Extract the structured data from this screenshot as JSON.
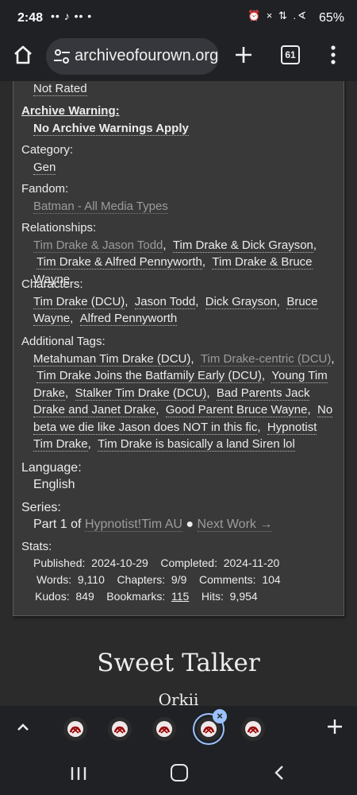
{
  "status_bar": {
    "time": "2:48",
    "notification_icons": "•• ♪ ••  •",
    "system_icons": "⏰ × ⇅ .∢",
    "battery": "65%"
  },
  "browser": {
    "url": "archiveofourown.org",
    "tab_count": "61"
  },
  "work_meta": {
    "rating_value": "Not Rated",
    "archive_warning_label": "Archive Warning:",
    "archive_warning_value": "No Archive Warnings Apply",
    "category_label": "Category:",
    "category_value": "Gen",
    "fandom_label": "Fandom:",
    "fandom_value": "Batman - All Media Types",
    "relationships_label": "Relationships:",
    "relationships": [
      "Tim Drake & Jason Todd",
      "Tim Drake & Dick Grayson",
      "Tim Drake & Alfred Pennyworth",
      "Tim Drake & Bruce Wayne"
    ],
    "characters_label": "Characters:",
    "characters": [
      "Tim Drake (DCU)",
      "Jason Todd",
      "Dick Grayson",
      "Bruce Wayne",
      "Alfred Pennyworth"
    ],
    "additional_tags_label": "Additional Tags:",
    "additional_tags": [
      "Metahuman Tim Drake (DCU)",
      "Tim Drake-centric (DCU)",
      "Tim Drake Joins the Batfamily Early (DCU)",
      "Young Tim Drake",
      "Stalker Tim Drake (DCU)",
      "Bad Parents Jack Drake and Janet Drake",
      "Good Parent Bruce Wayne",
      "No beta we die like Jason does NOT in this fic",
      "Hypnotist Tim Drake",
      "Tim Drake is basically a land Siren lol"
    ],
    "language_label": "Language:",
    "language_value": "English",
    "series_label": "Series:",
    "series_part": "Part 1 of",
    "series_name": "Hypnotist!Tim AU",
    "series_bullet": "●",
    "series_next": "Next Work →",
    "stats_label": "Stats:",
    "stats": {
      "published_label": "Published:",
      "published": "2024-10-29",
      "completed_label": "Completed:",
      "completed": "2024-11-20",
      "words_label": "Words:",
      "words": "9,110",
      "chapters_label": "Chapters:",
      "chapters": "9/9",
      "comments_label": "Comments:",
      "comments": "104",
      "kudos_label": "Kudos:",
      "kudos": "849",
      "bookmarks_label": "Bookmarks:",
      "bookmarks": "115",
      "hits_label": "Hits:",
      "hits": "9,954"
    }
  },
  "work": {
    "title": "Sweet Talker",
    "author": "Orkii"
  },
  "colors": {
    "page_bg": "#2b2b2b",
    "card_bg": "#393939",
    "chrome_bg": "#1f2125",
    "accent": "#9cc2ff",
    "dim_tag": "#9c9c9c"
  }
}
